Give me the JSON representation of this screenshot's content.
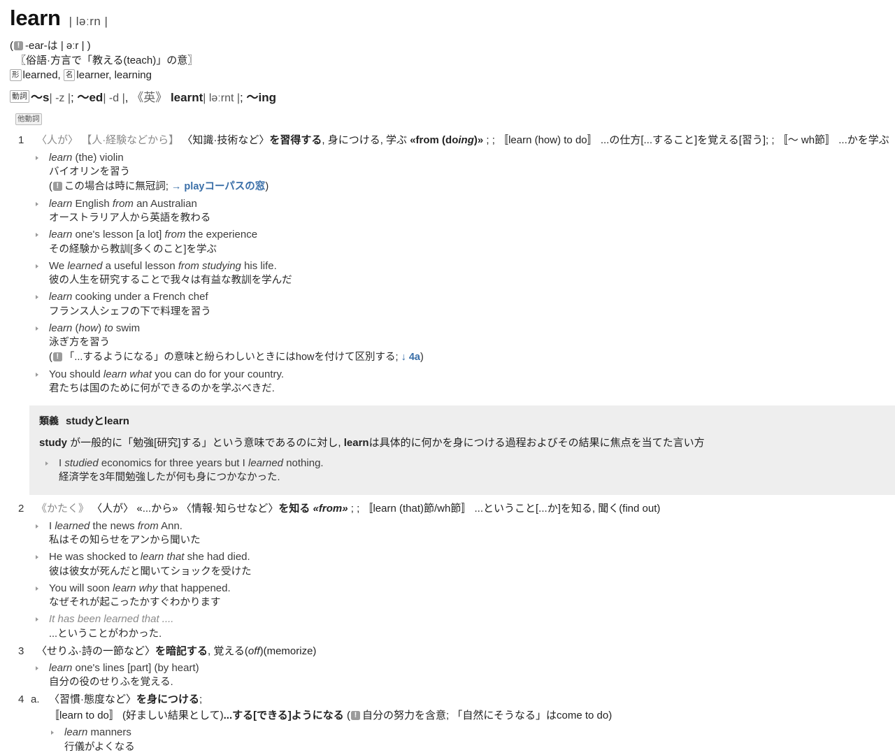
{
  "entry": {
    "headword": "learn",
    "ipa": "| ləːrn |",
    "notes": {
      "pronunciation_note_pre": "-ear-は | əːr |",
      "etymology": "〖俗語·方言で「教える(teach)」の意〗",
      "derivative_adj_tag": "形",
      "derivative_adj": "learned,",
      "derivative_noun_tag": "名",
      "derivative_noun": "learner, learning"
    },
    "inflection": {
      "pos_tag": "動詞",
      "s_form": "〜s",
      "s_ipa": "| -z |",
      "sep1": ";",
      "ed_form": "〜ed",
      "ed_ipa": "| -d |",
      "sep2": ",",
      "brit_label": "《英》",
      "brit_form": "learnt",
      "brit_ipa": "| ləːrnt |",
      "sep3": ";",
      "ing_form": "〜ing"
    },
    "transitive_tag": "他動詞"
  },
  "senses": [
    {
      "num": "1",
      "def_parts": [
        {
          "t": "〈人が〉",
          "s": "gray"
        },
        {
          "t": "  ",
          "s": "plain"
        },
        {
          "t": "【人·経験などから】",
          "s": "gray"
        },
        {
          "t": "  ",
          "s": "plain"
        },
        {
          "t": "〈知識·技術など〉",
          "s": "plain"
        },
        {
          "t": "を習得する",
          "s": "b"
        },
        {
          "t": ", 身につける, 学ぶ ",
          "s": "plain"
        },
        {
          "t": "«from (do",
          "s": "b"
        },
        {
          "t": "ing",
          "s": "bi"
        },
        {
          "t": ")»",
          "s": "b"
        },
        {
          "t": " ; ; 〚learn (how) to do〛 ",
          "s": "plain"
        },
        {
          "t": "...の仕方[...すること]を覚える[習う]",
          "s": "plain"
        },
        {
          "t": "; ; 〚〜 wh節〛 ",
          "s": "plain"
        },
        {
          "t": "...かを学ぶ",
          "s": "plain"
        }
      ],
      "examples": [
        {
          "en_parts": [
            {
              "t": "learn",
              "s": "i"
            },
            {
              "t": " (the) violin",
              "s": "plain"
            }
          ],
          "ja": "バイオリンを習う",
          "note_parts": [
            {
              "t": "(",
              "s": "plain"
            },
            {
              "t": "EXCL",
              "s": "excl"
            },
            {
              "t": "この場合は時に無冠詞; ",
              "s": "plain"
            },
            {
              "t": "→ play",
              "s": "link"
            },
            {
              "t": "コーパスの窓",
              "s": "link"
            },
            {
              "t": ")",
              "s": "plain"
            }
          ]
        },
        {
          "en_parts": [
            {
              "t": "learn",
              "s": "i"
            },
            {
              "t": " English ",
              "s": "plain"
            },
            {
              "t": "from",
              "s": "i"
            },
            {
              "t": " an Australian",
              "s": "plain"
            }
          ],
          "ja": "オーストラリア人から英語を教わる"
        },
        {
          "en_parts": [
            {
              "t": "learn",
              "s": "i"
            },
            {
              "t": " one's lesson [a lot] ",
              "s": "plain"
            },
            {
              "t": "from",
              "s": "i"
            },
            {
              "t": " the experience",
              "s": "plain"
            }
          ],
          "ja": "その経験から教訓[多くのこと]を学ぶ"
        },
        {
          "en_parts": [
            {
              "t": "We ",
              "s": "plain"
            },
            {
              "t": "learned",
              "s": "i"
            },
            {
              "t": " a useful lesson ",
              "s": "plain"
            },
            {
              "t": "from studying",
              "s": "i"
            },
            {
              "t": " his life.",
              "s": "plain"
            }
          ],
          "ja": "彼の人生を研究することで我々は有益な教訓を学んだ"
        },
        {
          "en_parts": [
            {
              "t": "learn",
              "s": "i"
            },
            {
              "t": " cooking under a French chef",
              "s": "plain"
            }
          ],
          "ja": "フランス人シェフの下で料理を習う"
        },
        {
          "en_parts": [
            {
              "t": "learn",
              "s": "i"
            },
            {
              "t": " (",
              "s": "plain"
            },
            {
              "t": "how",
              "s": "i"
            },
            {
              "t": ") ",
              "s": "plain"
            },
            {
              "t": "to",
              "s": "i"
            },
            {
              "t": " swim",
              "s": "plain"
            }
          ],
          "ja": "泳ぎ方を習う",
          "note_parts": [
            {
              "t": "(",
              "s": "plain"
            },
            {
              "t": "EXCL",
              "s": "excl"
            },
            {
              "t": "「...するようになる」の意味と紛らわしいときにはhowを付けて区別する; ",
              "s": "plain"
            },
            {
              "t": "↓ 4a",
              "s": "link"
            },
            {
              "t": ")",
              "s": "plain"
            }
          ]
        },
        {
          "en_parts": [
            {
              "t": "You should ",
              "s": "plain"
            },
            {
              "t": "learn what",
              "s": "i"
            },
            {
              "t": " you can do for your country.",
              "s": "plain"
            }
          ],
          "ja": "君たちは国のために何ができるのかを学ぶべきだ."
        }
      ]
    }
  ],
  "synonym_panel": {
    "tag": "類義",
    "title": "studyとlearn",
    "body_parts": [
      {
        "t": "study",
        "s": "b"
      },
      {
        "t": " が一般的に「勉強[研究]する」という意味であるのに対し, ",
        "s": "plain"
      },
      {
        "t": "learn",
        "s": "b"
      },
      {
        "t": "は具体的に何かを身につける過程およびその結果に焦点を当てた言い方",
        "s": "plain"
      }
    ],
    "example": {
      "en_parts": [
        {
          "t": "I ",
          "s": "plain"
        },
        {
          "t": "studied",
          "s": "i"
        },
        {
          "t": " economics for three years but I ",
          "s": "plain"
        },
        {
          "t": "learned",
          "s": "i"
        },
        {
          "t": " nothing.",
          "s": "plain"
        }
      ],
      "ja": "経済学を3年間勉強したが何も身につかなかった."
    }
  },
  "senses_after": [
    {
      "num": "2",
      "def_parts": [
        {
          "t": "《かたく》",
          "s": "gray"
        },
        {
          "t": " 〈人が〉 «...から» 〈情報·知らせなど〉",
          "s": "plain"
        },
        {
          "t": "を知る",
          "s": "b"
        },
        {
          "t": " ",
          "s": "plain"
        },
        {
          "t": "«from»",
          "s": "bi"
        },
        {
          "t": " ; ; 〚learn (that)節/wh節〛 ",
          "s": "plain"
        },
        {
          "t": "...ということ[...か]を知る, 聞く(find out)",
          "s": "plain"
        }
      ],
      "examples": [
        {
          "en_parts": [
            {
              "t": "I ",
              "s": "plain"
            },
            {
              "t": "learned",
              "s": "i"
            },
            {
              "t": " the news ",
              "s": "plain"
            },
            {
              "t": "from",
              "s": "i"
            },
            {
              "t": " Ann.",
              "s": "plain"
            }
          ],
          "ja": "私はその知らせをアンから聞いた"
        },
        {
          "en_parts": [
            {
              "t": "He was shocked to ",
              "s": "plain"
            },
            {
              "t": "learn that",
              "s": "i"
            },
            {
              "t": " she had died.",
              "s": "plain"
            }
          ],
          "ja": "彼は彼女が死んだと聞いてショックを受けた"
        },
        {
          "en_parts": [
            {
              "t": "You will soon ",
              "s": "plain"
            },
            {
              "t": "learn why",
              "s": "i"
            },
            {
              "t": " that happened.",
              "s": "plain"
            }
          ],
          "ja": "なぜそれが起こったかすぐわかります"
        },
        {
          "en_parts": [
            {
              "t": "It has been learned that ....",
              "s": "i-gray"
            }
          ],
          "ja": "...ということがわかった."
        }
      ]
    },
    {
      "num": "3",
      "def_parts": [
        {
          "t": "〈せりふ·詩の一節など〉",
          "s": "plain"
        },
        {
          "t": "を暗記する",
          "s": "b"
        },
        {
          "t": ", 覚える(",
          "s": "plain"
        },
        {
          "t": "off",
          "s": "i"
        },
        {
          "t": ")(memorize)",
          "s": "plain"
        }
      ],
      "examples": [
        {
          "en_parts": [
            {
              "t": "learn",
              "s": "i"
            },
            {
              "t": " one's lines [part] (by heart)",
              "s": "plain"
            }
          ],
          "ja": "自分の役のせりふを覚える."
        }
      ]
    },
    {
      "num": "4",
      "def_parts": [],
      "subsenses": [
        {
          "letter": "a.",
          "line1_parts": [
            {
              "t": "〈習慣·態度など〉",
              "s": "plain"
            },
            {
              "t": "を身につける",
              "s": "b"
            },
            {
              "t": ";",
              "s": "plain"
            }
          ],
          "line2_parts": [
            {
              "t": "〚learn to do〛",
              "s": "plain"
            },
            {
              "t": " (好ましい結果として)",
              "s": "plain"
            },
            {
              "t": "...する[できる]ようになる",
              "s": "b"
            },
            {
              "t": " (",
              "s": "plain"
            },
            {
              "t": "EXCL",
              "s": "excl"
            },
            {
              "t": "自分の努力を含意; 「自然にそうなる」はcome to do)",
              "s": "plain"
            }
          ],
          "examples": [
            {
              "en_parts": [
                {
                  "t": "learn",
                  "s": "i"
                },
                {
                  "t": " manners",
                  "s": "plain"
                }
              ],
              "ja": "行儀がよくなる"
            }
          ]
        }
      ]
    }
  ]
}
